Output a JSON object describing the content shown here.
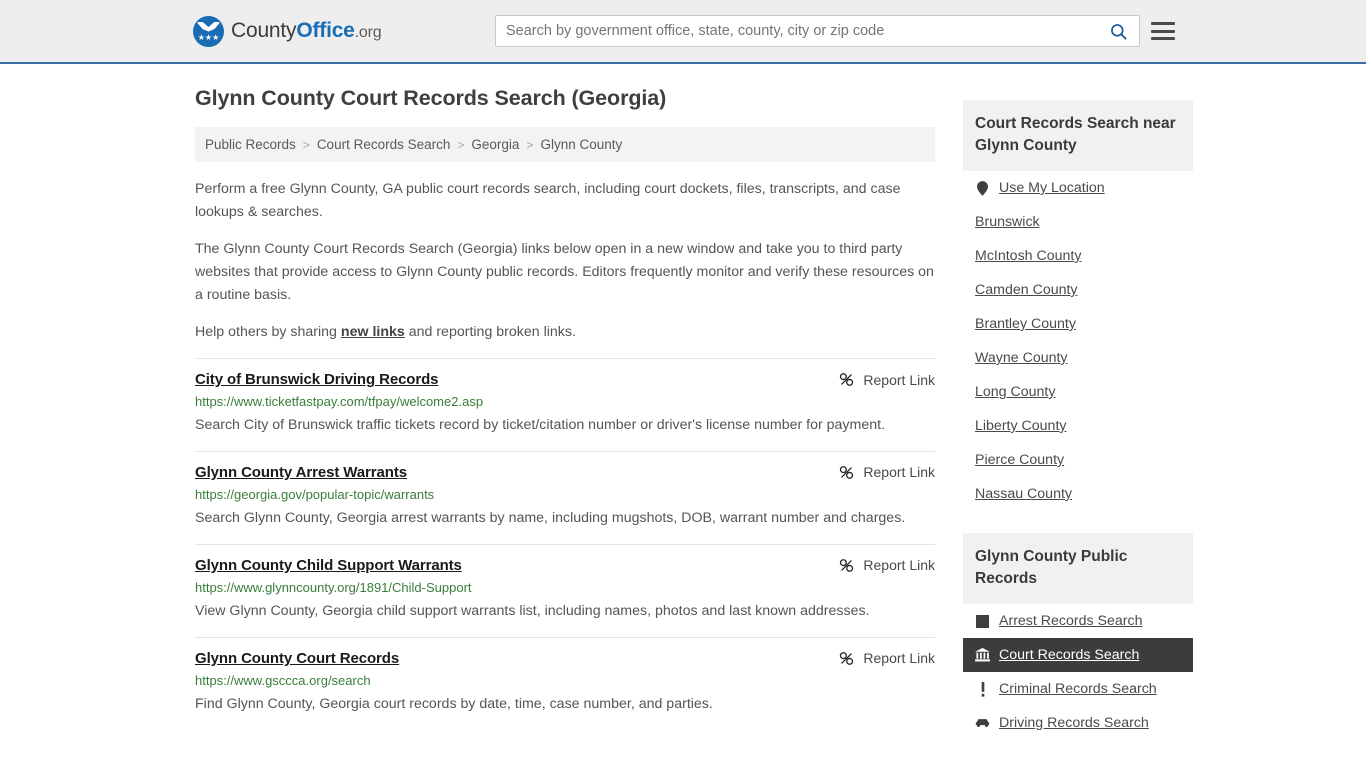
{
  "header": {
    "logo_text_pre": "County",
    "logo_text_bold": "Office",
    "logo_text_tld": ".org",
    "logo_stars": "★★★",
    "search_placeholder": "Search by government office, state, county, city or zip code",
    "search_value": "",
    "search_icon": "search-icon",
    "menu_icon": "hamburger-menu-icon",
    "accent_color": "#1a6cb5",
    "border_color": "#3d6fa5"
  },
  "page": {
    "title": "Glynn County Court Records Search (Georgia)"
  },
  "breadcrumb": {
    "separator": ">",
    "items": [
      {
        "label": "Public Records"
      },
      {
        "label": "Court Records Search"
      },
      {
        "label": "Georgia"
      },
      {
        "label": "Glynn County"
      }
    ]
  },
  "intro": {
    "p1": "Perform a free Glynn County, GA public court records search, including court dockets, files, transcripts, and case lookups & searches.",
    "p2": "The Glynn County Court Records Search (Georgia) links below open in a new window and take you to third party websites that provide access to Glynn County public records. Editors frequently monitor and verify these resources on a routine basis.",
    "p3_before": "Help others by sharing ",
    "p3_link": "new links",
    "p3_after": " and reporting broken links."
  },
  "results": {
    "report_label": "Report Link",
    "report_icon": "broken-link-icon",
    "items": [
      {
        "title": "City of Brunswick Driving Records",
        "url": "https://www.ticketfastpay.com/tfpay/welcome2.asp",
        "description": "Search City of Brunswick traffic tickets record by ticket/citation number or driver's license number for payment."
      },
      {
        "title": "Glynn County Arrest Warrants",
        "url": "https://georgia.gov/popular-topic/warrants",
        "description": "Search Glynn County, Georgia arrest warrants by name, including mugshots, DOB, warrant number and charges."
      },
      {
        "title": "Glynn County Child Support Warrants",
        "url": "https://www.glynncounty.org/1891/Child-Support",
        "description": "View Glynn County, Georgia child support warrants list, including names, photos and last known addresses."
      },
      {
        "title": "Glynn County Court Records",
        "url": "https://www.gsccca.org/search",
        "description": "Find Glynn County, Georgia court records by date, time, case number, and parties."
      }
    ]
  },
  "sidebar": {
    "nearby": {
      "heading": "Court Records Search near Glynn County",
      "items": [
        {
          "label": "Use My Location",
          "icon": "location-pin-icon"
        },
        {
          "label": "Brunswick",
          "icon": ""
        },
        {
          "label": "McIntosh County",
          "icon": ""
        },
        {
          "label": "Camden County",
          "icon": ""
        },
        {
          "label": "Brantley County",
          "icon": ""
        },
        {
          "label": "Wayne County",
          "icon": ""
        },
        {
          "label": "Long County",
          "icon": ""
        },
        {
          "label": "Liberty County",
          "icon": ""
        },
        {
          "label": "Pierce County",
          "icon": ""
        },
        {
          "label": "Nassau County",
          "icon": ""
        }
      ]
    },
    "public_records": {
      "heading": "Glynn County Public Records",
      "active_bg": "#3c3c3c",
      "items": [
        {
          "label": "Arrest Records Search",
          "icon": "square-icon",
          "active": false
        },
        {
          "label": "Court Records Search",
          "icon": "bank-icon",
          "active": true
        },
        {
          "label": "Criminal Records Search",
          "icon": "exclamation-icon",
          "active": false
        },
        {
          "label": "Driving Records Search",
          "icon": "car-icon",
          "active": false
        }
      ]
    }
  }
}
